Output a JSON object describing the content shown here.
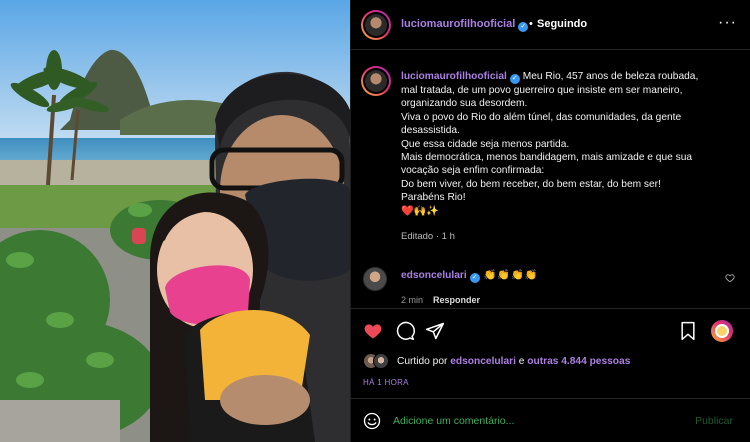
{
  "post": {
    "author": "luciomaurofilhooficial",
    "verified_mark": "✓",
    "separator": "•",
    "follow_status": "Seguindo",
    "more_glyph": "···"
  },
  "caption": {
    "author": "luciomaurofilhooficial",
    "lines": [
      "Meu Rio, 457 anos de beleza roubada,",
      "mal tratada, de um povo guerreiro que insiste em ser maneiro,",
      "organizando sua desordem.",
      "Viva o povo do Rio do além túnel, das comunidades, da gente",
      "desassistida.",
      "Que essa cidade seja menos partida.",
      "Mais democrática, menos bandidagem, mais amizade e que sua",
      "vocação seja enfim confirmada:",
      "Do bem viver, do bem receber, do bem estar, do bem ser!",
      "Parabéns Rio!",
      "❤️🙌✨"
    ],
    "meta": "Editado · 1 h"
  },
  "reply": {
    "author": "edsoncelulari",
    "text": "👏👏👏👏",
    "age": "2 min",
    "reply_label": "Responder"
  },
  "likes": {
    "prefix": "Curtido por",
    "user": "edsoncelulari",
    "conj": "e",
    "others": "outras 4.844 pessoas"
  },
  "time_ago": "HÁ 1 HORA",
  "comment_box": {
    "placeholder": "Adicione um comentário...",
    "publish_label": "Publicar"
  },
  "icons": [
    "heart-icon",
    "comment-icon",
    "share-icon",
    "bookmark-icon",
    "emoji-icon",
    "more-icon",
    "verified-icon"
  ],
  "colors": {
    "username": "#ad7fe4",
    "like": "#ed4956",
    "verified": "#3897f0",
    "comment_placeholder": "#3fae5a"
  }
}
